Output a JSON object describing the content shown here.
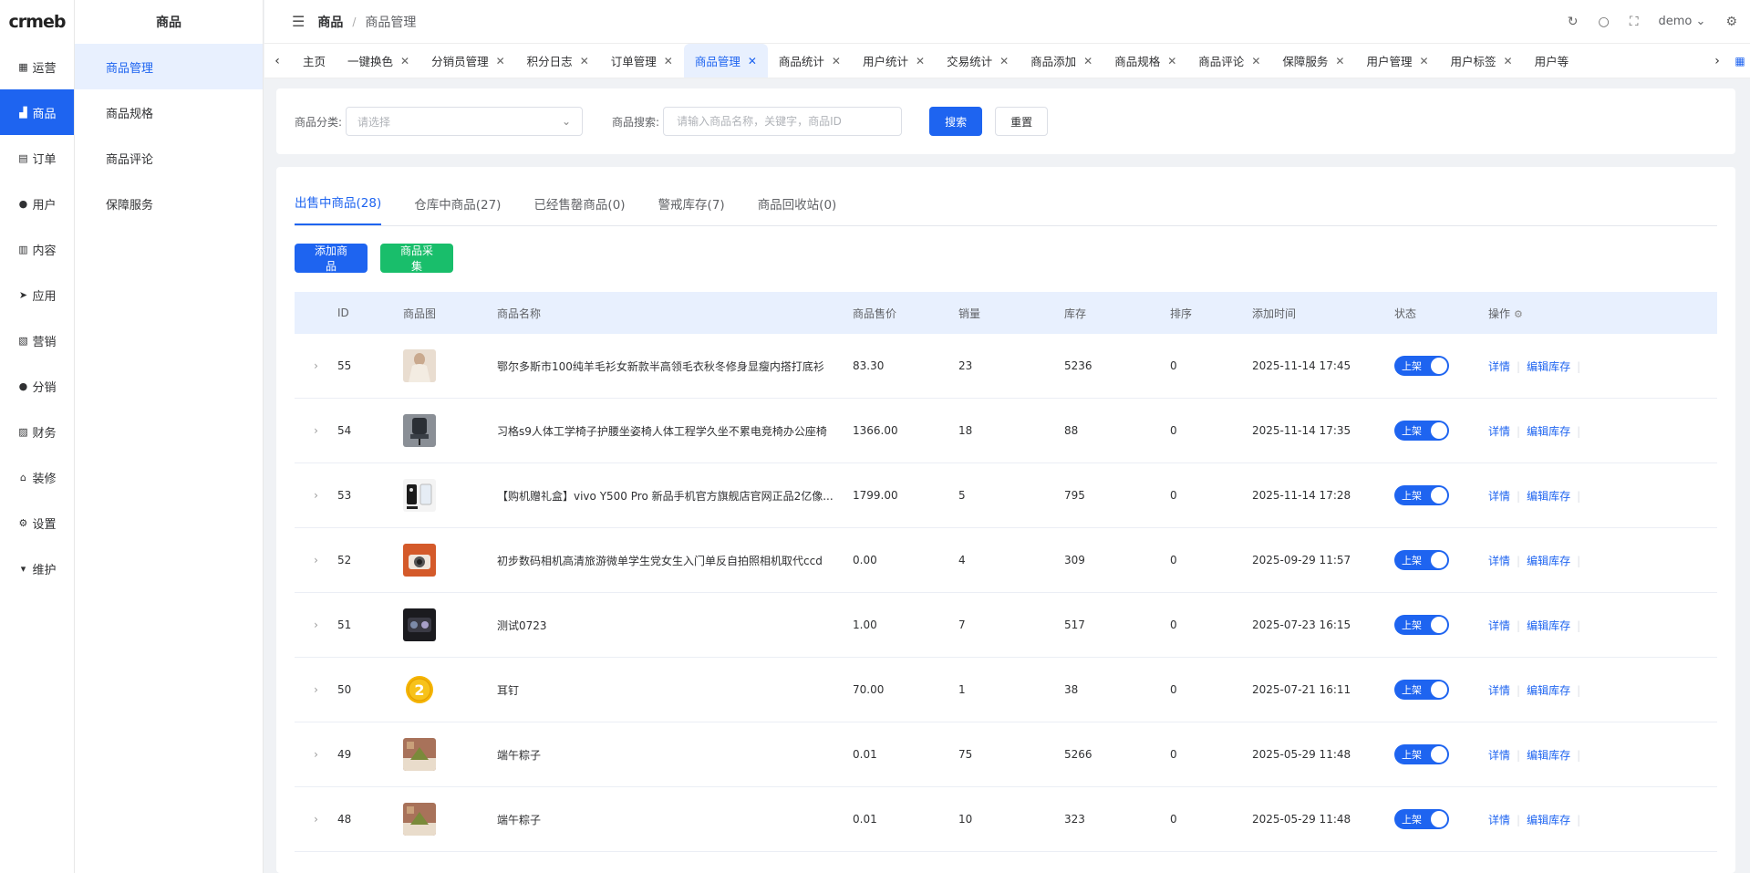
{
  "logo": "crmeb",
  "rail": [
    {
      "icon": "dashboard-icon",
      "glyph": "▦",
      "label": "运营"
    },
    {
      "icon": "bag-icon",
      "glyph": "▟",
      "label": "商品",
      "active": true
    },
    {
      "icon": "clipboard-icon",
      "glyph": "▤",
      "label": "订单"
    },
    {
      "icon": "user-icon",
      "glyph": "●",
      "label": "用户"
    },
    {
      "icon": "content-icon",
      "glyph": "▥",
      "label": "内容"
    },
    {
      "icon": "send-icon",
      "glyph": "➤",
      "label": "应用"
    },
    {
      "icon": "chart-icon",
      "glyph": "▧",
      "label": "营销"
    },
    {
      "icon": "distribution-icon",
      "glyph": "●",
      "label": "分销"
    },
    {
      "icon": "finance-icon",
      "glyph": "▨",
      "label": "财务"
    },
    {
      "icon": "home-icon",
      "glyph": "⌂",
      "label": "装修"
    },
    {
      "icon": "settings-icon",
      "glyph": "⚙",
      "label": "设置"
    },
    {
      "icon": "maintain-icon",
      "glyph": "▾",
      "label": "维护"
    }
  ],
  "submenu": {
    "title": "商品",
    "items": [
      "商品管理",
      "商品规格",
      "商品评论",
      "保障服务"
    ]
  },
  "header": {
    "breadcrumb_main": "商品",
    "breadcrumb_sub": "商品管理",
    "user": "demo"
  },
  "tabs": [
    {
      "label": "主页",
      "closable": false
    },
    {
      "label": "一键换色",
      "closable": true
    },
    {
      "label": "分销员管理",
      "closable": true
    },
    {
      "label": "积分日志",
      "closable": true
    },
    {
      "label": "订单管理",
      "closable": true
    },
    {
      "label": "商品管理",
      "closable": true,
      "active": true
    },
    {
      "label": "商品统计",
      "closable": true
    },
    {
      "label": "用户统计",
      "closable": true
    },
    {
      "label": "交易统计",
      "closable": true
    },
    {
      "label": "商品添加",
      "closable": true
    },
    {
      "label": "商品规格",
      "closable": true
    },
    {
      "label": "商品评论",
      "closable": true
    },
    {
      "label": "保障服务",
      "closable": true
    },
    {
      "label": "用户管理",
      "closable": true
    },
    {
      "label": "用户标签",
      "closable": true
    },
    {
      "label": "用户等",
      "closable": false
    }
  ],
  "filter": {
    "category_label": "商品分类:",
    "category_placeholder": "请选择",
    "search_label": "商品搜索:",
    "search_placeholder": "请输入商品名称，关键字，商品ID",
    "search_button": "搜索",
    "reset_button": "重置"
  },
  "status_tabs": [
    "出售中商品(28)",
    "仓库中商品(27)",
    "已经售罄商品(0)",
    "警戒库存(7)",
    "商品回收站(0)"
  ],
  "buttons": {
    "add": "添加商品",
    "collect": "商品采集"
  },
  "table": {
    "headers": {
      "id": "ID",
      "image": "商品图",
      "name": "商品名称",
      "price": "商品售价",
      "sales": "销量",
      "stock": "库存",
      "sort": "排序",
      "time": "添加时间",
      "status": "状态",
      "ops": "操作"
    },
    "status_label": "上架",
    "op_detail": "详情",
    "op_stock": "编辑库存",
    "rows": [
      {
        "id": "55",
        "name": "鄂尔多斯市100纯羊毛衫女新款半高领毛衣秋冬修身显瘦内搭打底衫",
        "price": "83.30",
        "sales": "23",
        "stock": "5236",
        "sort": "0",
        "time": "2025-11-14 17:45",
        "thumb": "sweater"
      },
      {
        "id": "54",
        "name": "习格s9人体工学椅子护腰坐姿椅人体工程学久坐不累电竞椅办公座椅",
        "price": "1366.00",
        "sales": "18",
        "stock": "88",
        "sort": "0",
        "time": "2025-11-14 17:35",
        "thumb": "chair"
      },
      {
        "id": "53",
        "name": "【购机赠礼盒】vivo Y500 Pro 新品手机官方旗舰店官网正品2亿像...",
        "price": "1799.00",
        "sales": "5",
        "stock": "795",
        "sort": "0",
        "time": "2025-11-14 17:28",
        "thumb": "phone"
      },
      {
        "id": "52",
        "name": "初步数码相机高清旅游微单学生党女生入门单反自拍照相机取代ccd",
        "price": "0.00",
        "sales": "4",
        "stock": "309",
        "sort": "0",
        "time": "2025-09-29 11:57",
        "thumb": "camera"
      },
      {
        "id": "51",
        "name": "测试0723",
        "price": "1.00",
        "sales": "7",
        "stock": "517",
        "sort": "0",
        "time": "2025-07-23 16:15",
        "thumb": "dark"
      },
      {
        "id": "50",
        "name": "耳钉",
        "price": "70.00",
        "sales": "1",
        "stock": "38",
        "sort": "0",
        "time": "2025-07-21 16:11",
        "thumb": "badge"
      },
      {
        "id": "49",
        "name": "端午粽子",
        "price": "0.01",
        "sales": "75",
        "stock": "5266",
        "sort": "0",
        "time": "2025-05-29 11:48",
        "thumb": "zongzi"
      },
      {
        "id": "48",
        "name": "端午粽子",
        "price": "0.01",
        "sales": "10",
        "stock": "323",
        "sort": "0",
        "time": "2025-05-29 11:48",
        "thumb": "zongzi"
      }
    ]
  }
}
